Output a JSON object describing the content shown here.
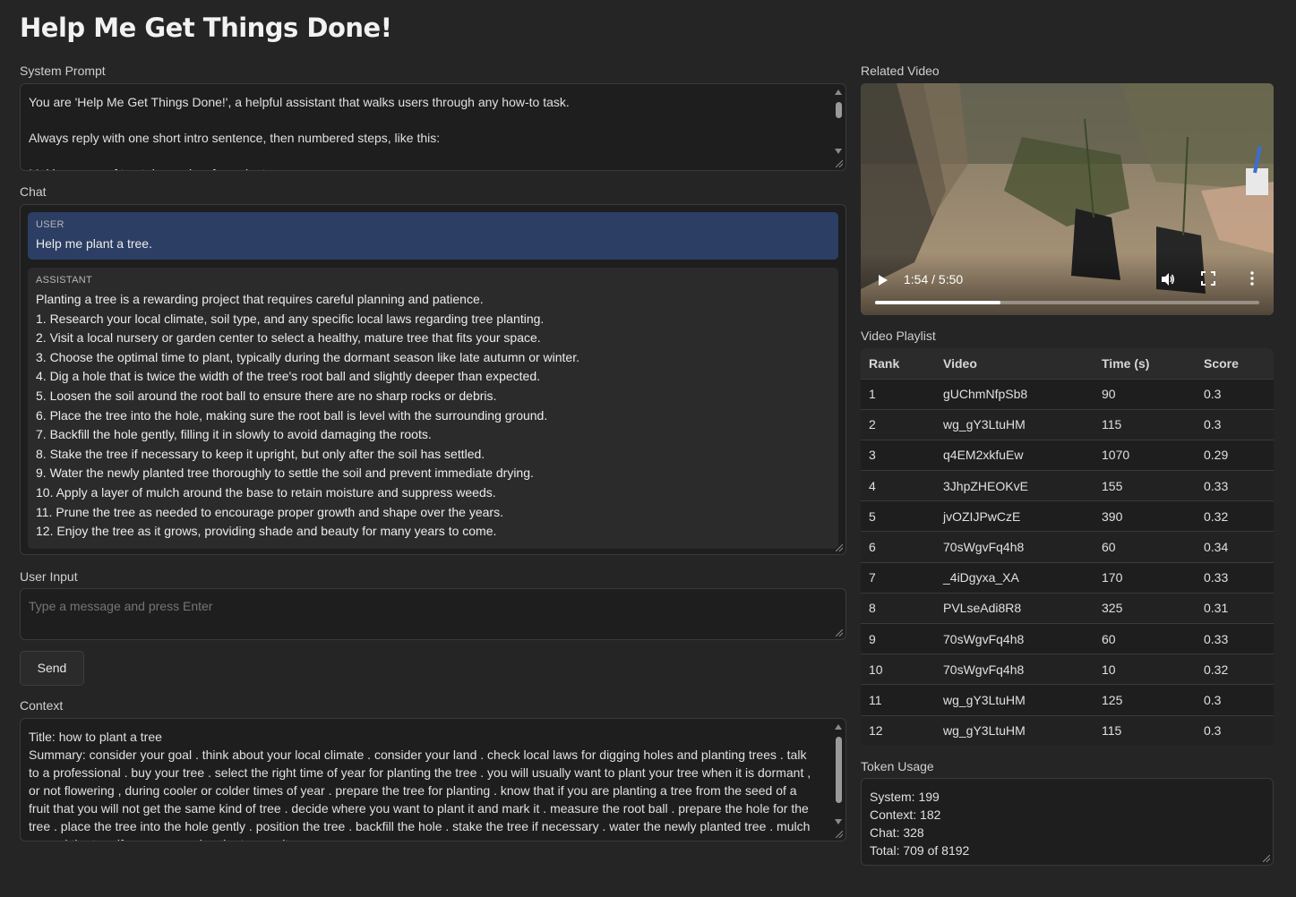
{
  "title": "Help Me Get Things Done!",
  "system_prompt": {
    "label": "System Prompt",
    "text": "You are 'Help Me Get Things Done!', a helpful assistant that walks users through any how-to task.\n\nAlways reply with one short intro sentence, then numbered steps, like this:\n\nMaking a cup of tea takes only a few minutes."
  },
  "chat": {
    "label": "Chat",
    "messages": [
      {
        "role": "USER",
        "text": "Help me plant a tree."
      },
      {
        "role": "ASSISTANT",
        "text": "Planting a tree is a rewarding project that requires careful planning and patience.\n1. Research your local climate, soil type, and any specific local laws regarding tree planting.\n2. Visit a local nursery or garden center to select a healthy, mature tree that fits your space.\n3. Choose the optimal time to plant, typically during the dormant season like late autumn or winter.\n4. Dig a hole that is twice the width of the tree's root ball and slightly deeper than expected.\n5. Loosen the soil around the root ball to ensure there are no sharp rocks or debris.\n6. Place the tree into the hole, making sure the root ball is level with the surrounding ground.\n7. Backfill the hole gently, filling it in slowly to avoid damaging the roots.\n8. Stake the tree if necessary to keep it upright, but only after the soil has settled.\n9. Water the newly planted tree thoroughly to settle the soil and prevent immediate drying.\n10. Apply a layer of mulch around the base to retain moisture and suppress weeds.\n11. Prune the tree as needed to encourage proper growth and shape over the years.\n12. Enjoy the tree as it grows, providing shade and beauty for many years to come."
      }
    ]
  },
  "user_input": {
    "label": "User Input",
    "placeholder": "Type a message and press Enter",
    "value": ""
  },
  "send_label": "Send",
  "context": {
    "label": "Context",
    "text": "Title: how to plant a tree\nSummary: consider your goal . think about your local climate . consider your land . check local laws for digging holes and planting trees . talk to a professional . buy your tree . select the right time of year for planting the tree . you will usually want to plant your tree when it is dormant , or not flowering , during cooler or colder times of year . prepare the tree for planting . know that if you are planting a tree from the seed of a fruit that you will not get the same kind of tree . decide where you want to plant it and mark it . measure the root ball . prepare the hole for the tree . place the tree into the hole gently . position the tree . backfill the hole . stake the tree if necessary . water the newly planted tree . mulch around the tree if you are growing the tree as it grows ."
  },
  "video": {
    "label": "Related Video",
    "time_display": "1:54 / 5:50",
    "progress": 0.326
  },
  "playlist": {
    "label": "Video Playlist",
    "columns": [
      "Rank",
      "Video",
      "Time (s)",
      "Score"
    ],
    "rows": [
      [
        "1",
        "gUChmNfpSb8",
        "90",
        "0.3"
      ],
      [
        "2",
        "wg_gY3LtuHM",
        "115",
        "0.3"
      ],
      [
        "3",
        "q4EM2xkfuEw",
        "1070",
        "0.29"
      ],
      [
        "4",
        "3JhpZHEOKvE",
        "155",
        "0.33"
      ],
      [
        "5",
        "jvOZIJPwCzE",
        "390",
        "0.32"
      ],
      [
        "6",
        "70sWgvFq4h8",
        "60",
        "0.34"
      ],
      [
        "7",
        "_4iDgyxa_XA",
        "170",
        "0.33"
      ],
      [
        "8",
        "PVLseAdi8R8",
        "325",
        "0.31"
      ],
      [
        "9",
        "70sWgvFq4h8",
        "60",
        "0.33"
      ],
      [
        "10",
        "70sWgvFq4h8",
        "10",
        "0.32"
      ],
      [
        "11",
        "wg_gY3LtuHM",
        "125",
        "0.3"
      ],
      [
        "12",
        "wg_gY3LtuHM",
        "115",
        "0.3"
      ]
    ]
  },
  "token_usage": {
    "label": "Token Usage",
    "lines": [
      "System: 199",
      "Context: 182",
      "Chat: 328",
      "Total: 709 of 8192"
    ]
  },
  "colors": {
    "background": "#252526",
    "panel": "#1e1e1e",
    "user_bubble": "#2c3e63",
    "assistant_bubble": "#2b2b2b"
  }
}
